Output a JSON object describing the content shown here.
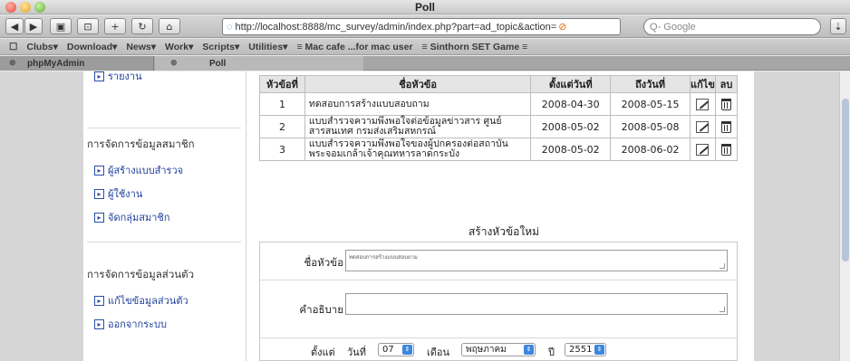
{
  "window": {
    "title": "Poll"
  },
  "toolbar": {
    "url": "http://localhost:8888/mc_survey/admin/index.php?part=ad_topic&action=",
    "search_placeholder": "Q- Google"
  },
  "bookmarks": [
    "Clubs▾",
    "Download▾",
    "News▾",
    "Work▾",
    "Scripts▾",
    "Utilities▾",
    "≡ Mac cafe ...for mac user",
    "≡ Sinthorn SET Game ≡"
  ],
  "tabs": [
    {
      "label": "phpMyAdmin",
      "active": false
    },
    {
      "label": "Poll",
      "active": true
    }
  ],
  "sidebar": {
    "top_link": "รายงาน",
    "section1": "การจัดการข้อมูลสมาชิก",
    "section1_links": [
      "ผู้สร้างแบบสำรวจ",
      "ผู้ใช้งาน",
      "จัดกลุ่มสมาชิก"
    ],
    "section2": "การจัดการข้อมูลส่วนตัว",
    "section2_links": [
      "แก้ไขข้อมูลส่วนตัว",
      "ออกจากระบบ"
    ]
  },
  "table": {
    "headers": [
      "หัวข้อที่",
      "ชื่อหัวข้อ",
      "ตั้งแต่วันที่",
      "ถึงวันที่",
      "แก้ไข",
      "ลบ"
    ],
    "rows": [
      {
        "num": "1",
        "title": "ทดสอบการสร้างแบบสอบถาม",
        "from": "2008-04-30",
        "to": "2008-05-15"
      },
      {
        "num": "2",
        "title": "แบบสำรวจความพึงพอใจต่อข้อมูลข่าวสาร ศูนย์สารสนเทศ กรมส่งเสริมสหกรณ์",
        "from": "2008-05-02",
        "to": "2008-05-08"
      },
      {
        "num": "3",
        "title": "แบบสำรวจความพึงพอใจของผู้ปกครองต่อสถาบันพระจอมเกล้าเจ้าคุณทหารลาดกระบัง",
        "from": "2008-05-02",
        "to": "2008-06-02"
      }
    ]
  },
  "form": {
    "title": "สร้างหัวข้อใหม่",
    "topic_label": "ชื่อหัวข้อ",
    "topic_value": "ทดสอบการสร้างแบบสอบถาม",
    "desc_label": "คำอธิบาย",
    "desc_value": "",
    "from_label": "ตั้งแต่",
    "day_label": "วันที่",
    "day_value": "07",
    "month_label": "เดือน",
    "month_value": "พฤษภาคม",
    "year_label": "ปี",
    "year_value": "2551"
  }
}
